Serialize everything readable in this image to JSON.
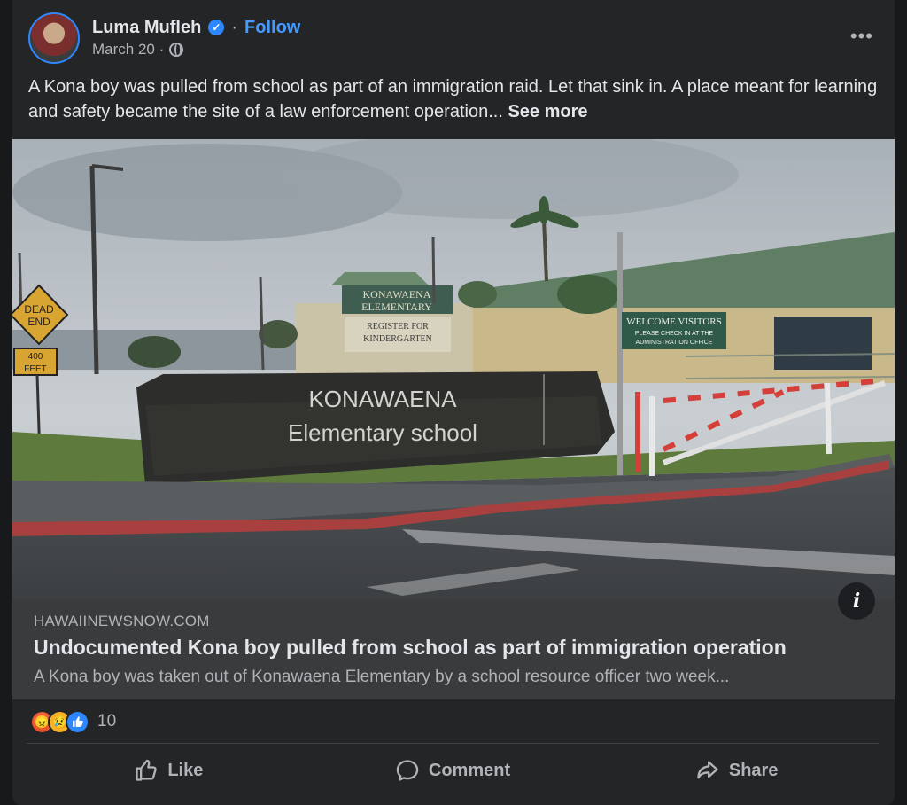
{
  "post": {
    "author": "Luma Mufleh",
    "separator": "·",
    "follow_label": "Follow",
    "date": "March 20 ·",
    "text": "A Kona boy was pulled from school as part of an immigration raid. Let that sink in. A place meant for learning and safety became the site of a law enforcement operation...",
    "see_more_label": "See more"
  },
  "link": {
    "domain": "HAWAIINEWSNOW.COM",
    "headline": "Undocumented Kona boy pulled from school as part of immigration operation",
    "description": "A Kona boy was taken out of Konawaena Elementary by a school resource officer two week...",
    "image_text": {
      "school_sign_1": "KONAWAENA",
      "school_sign_2": "Elementary school",
      "banner_1": "KONAWAENA",
      "banner_2": "ELEMENTARY",
      "register_1": "REGISTER FOR",
      "register_2": "KINDERGARTEN",
      "welcome_1": "WELCOME VISITORS",
      "welcome_2": "PLEASE CHECK IN AT THE",
      "welcome_3": "ADMINISTRATION OFFICE",
      "road_1": "DEAD",
      "road_2": "END",
      "road_3": "400",
      "road_4": "FEET"
    },
    "info_icon": "i"
  },
  "reactions": {
    "icons": [
      "angry-icon",
      "sad-icon",
      "like-icon"
    ],
    "count": "10"
  },
  "actions": {
    "like": "Like",
    "comment": "Comment",
    "share": "Share"
  },
  "colors": {
    "background": "#18191a",
    "card": "#242526",
    "accent": "#4599ff",
    "text": "#e4e6eb",
    "muted": "#b0b3b8"
  }
}
